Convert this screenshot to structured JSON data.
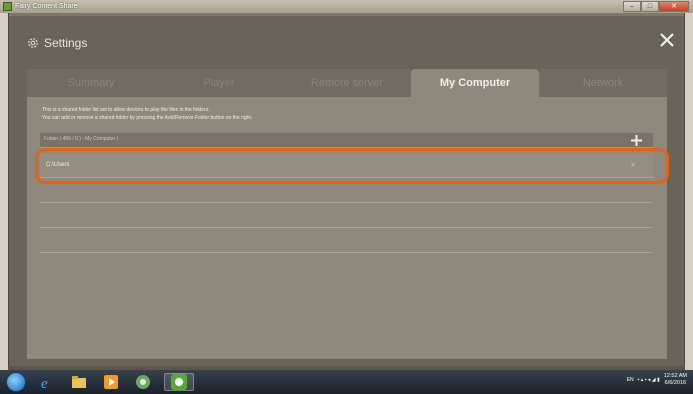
{
  "window": {
    "title": "Fairy Content Share",
    "minimize": "–",
    "maximize": "□",
    "close": "✕"
  },
  "settings": {
    "title": "Settings"
  },
  "tabs": [
    {
      "label": "Summary"
    },
    {
      "label": "Player"
    },
    {
      "label": "Remote server"
    },
    {
      "label": "My Computer"
    },
    {
      "label": "Network"
    }
  ],
  "info": {
    "line1": "This is a shared folder list set to allow devices to play the files in the folders.",
    "line2": "You can add or remove a shared folder by pressing the Add/Remove Folder button on the right."
  },
  "folder_list": {
    "header": "Folder ( 456 / 0 ) : My Computer )",
    "rows": [
      {
        "path": "C:\\Users",
        "remove": "x"
      }
    ]
  },
  "taskbar": {
    "lang": "EN",
    "time": "12:52 AM",
    "date": "6/6/2016"
  },
  "colors": {
    "highlight": "#e0641d",
    "active_tab": "#8e897c"
  }
}
